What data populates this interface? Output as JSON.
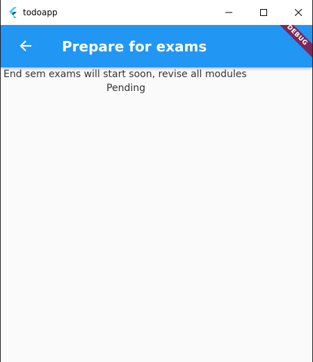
{
  "window": {
    "title": "todoapp"
  },
  "appbar": {
    "title": "Prepare for exams",
    "debug_label": "DEBUG",
    "color": "#2196f3"
  },
  "task": {
    "description": "End sem exams will start soon, revise all modules",
    "status": "Pending"
  },
  "icons": {
    "app_logo": "flutter-logo-icon",
    "minimize": "minimize-icon",
    "maximize": "maximize-icon",
    "close": "close-icon",
    "back": "arrow-left-icon"
  }
}
